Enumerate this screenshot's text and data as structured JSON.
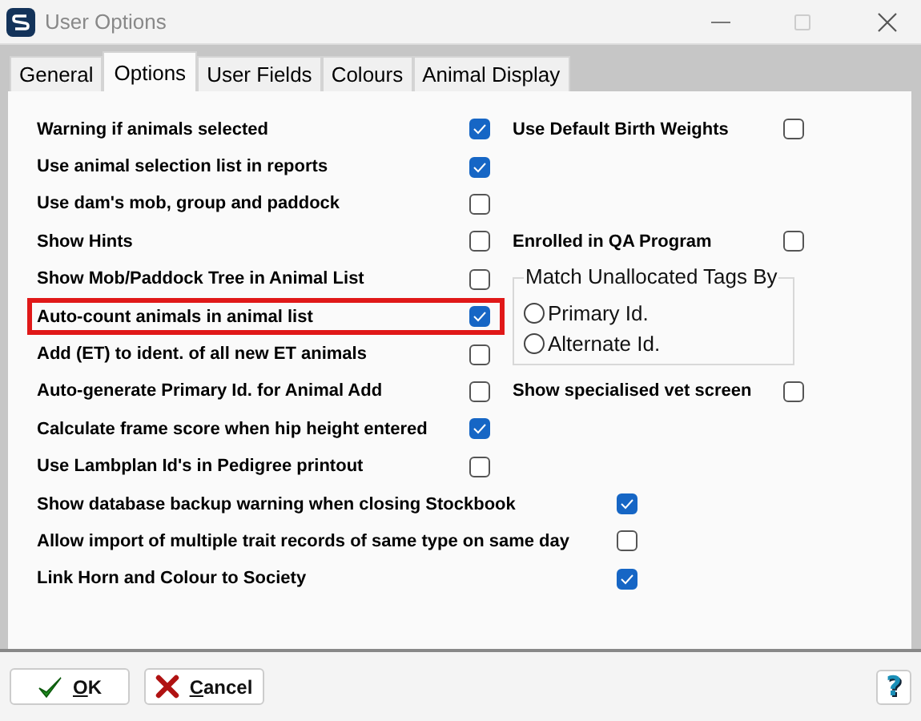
{
  "window": {
    "title": "User Options"
  },
  "tabs": [
    {
      "label": "General",
      "selected": false
    },
    {
      "label": "Options",
      "selected": true
    },
    {
      "label": "User Fields",
      "selected": false
    },
    {
      "label": "Colours",
      "selected": false
    },
    {
      "label": "Animal Display",
      "selected": false
    }
  ],
  "left_options": [
    {
      "label": "Warning if animals selected",
      "checked": true,
      "highlighted": false
    },
    {
      "label": "Use animal selection list in reports",
      "checked": true,
      "highlighted": false
    },
    {
      "label": "Use dam's mob, group and paddock",
      "checked": false,
      "highlighted": false
    },
    {
      "label": "Show Hints",
      "checked": false,
      "highlighted": false
    },
    {
      "label": "Show Mob/Paddock Tree in Animal List",
      "checked": false,
      "highlighted": false
    },
    {
      "label": "Auto-count animals in animal list",
      "checked": true,
      "highlighted": true
    },
    {
      "label": "Add (ET) to ident. of all new ET animals",
      "checked": false,
      "highlighted": false
    },
    {
      "label": "Auto-generate Primary Id. for Animal Add",
      "checked": false,
      "highlighted": false
    },
    {
      "label": "Calculate frame score when hip height entered",
      "checked": true,
      "highlighted": false
    },
    {
      "label": "Use Lambplan Id's in Pedigree printout",
      "checked": false,
      "highlighted": false
    }
  ],
  "right_options": [
    {
      "kind": "checkbox",
      "label": "Use Default Birth Weights",
      "checked": false
    },
    {
      "kind": "checkbox",
      "label": "Enrolled in QA Program",
      "checked": false
    },
    {
      "kind": "radio_group",
      "title": "Match Unallocated Tags By",
      "options": [
        {
          "label": "Primary Id.",
          "selected": false
        },
        {
          "label": "Alternate Id.",
          "selected": false
        }
      ]
    },
    {
      "kind": "checkbox",
      "label": "Show specialised vet screen",
      "checked": false
    }
  ],
  "wide_options": [
    {
      "label": "Show database backup warning when closing Stockbook",
      "checked": true
    },
    {
      "label": "Allow import of multiple trait records of same type on same day",
      "checked": false
    },
    {
      "label": "Link Horn and Colour to Society",
      "checked": true
    }
  ],
  "buttons": [
    {
      "kind": "ok",
      "label": "OK"
    },
    {
      "kind": "cancel",
      "label": "Cancel"
    }
  ],
  "help_button": {
    "label": "?"
  }
}
